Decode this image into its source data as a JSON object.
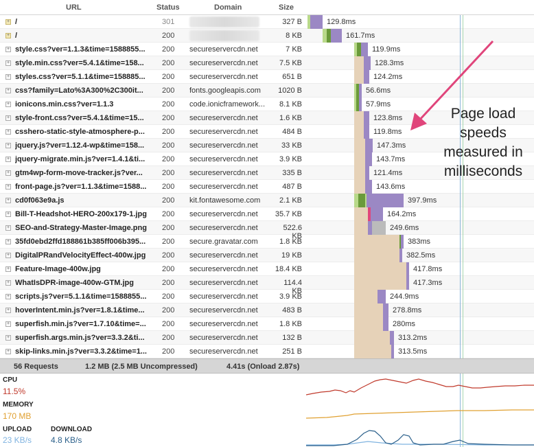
{
  "columns": {
    "url": "URL",
    "status": "Status",
    "domain": "Domain",
    "size": "Size"
  },
  "requests": [
    {
      "url": "/",
      "status": "301",
      "domain": "",
      "size": "327 B",
      "time": "129.8ms"
    },
    {
      "url": "/",
      "status": "200",
      "domain": "",
      "size": "8 KB",
      "time": "161.7ms"
    },
    {
      "url": "style.css?ver=1.1.3&time=1588855...",
      "status": "200",
      "domain": "secureservercdn.net",
      "size": "7 KB",
      "time": "119.9ms"
    },
    {
      "url": "style.min.css?ver=5.4.1&time=158...",
      "status": "200",
      "domain": "secureservercdn.net",
      "size": "7.5 KB",
      "time": "128.3ms"
    },
    {
      "url": "styles.css?ver=5.1.1&time=158885...",
      "status": "200",
      "domain": "secureservercdn.net",
      "size": "651 B",
      "time": "124.2ms"
    },
    {
      "url": "css?family=Lato%3A300%2C300it...",
      "status": "200",
      "domain": "fonts.googleapis.com",
      "size": "1020 B",
      "time": "56.6ms"
    },
    {
      "url": "ionicons.min.css?ver=1.1.3",
      "status": "200",
      "domain": "code.ionicframework...",
      "size": "8.1 KB",
      "time": "57.9ms"
    },
    {
      "url": "style-front.css?ver=5.4.1&time=15...",
      "status": "200",
      "domain": "secureservercdn.net",
      "size": "1.6 KB",
      "time": "123.8ms"
    },
    {
      "url": "csshero-static-style-atmosphere-p...",
      "status": "200",
      "domain": "secureservercdn.net",
      "size": "484 B",
      "time": "119.8ms"
    },
    {
      "url": "jquery.js?ver=1.12.4-wp&time=158...",
      "status": "200",
      "domain": "secureservercdn.net",
      "size": "33 KB",
      "time": "147.3ms"
    },
    {
      "url": "jquery-migrate.min.js?ver=1.4.1&ti...",
      "status": "200",
      "domain": "secureservercdn.net",
      "size": "3.9 KB",
      "time": "143.7ms"
    },
    {
      "url": "gtm4wp-form-move-tracker.js?ver...",
      "status": "200",
      "domain": "secureservercdn.net",
      "size": "335 B",
      "time": "121.4ms"
    },
    {
      "url": "front-page.js?ver=1.1.3&time=1588...",
      "status": "200",
      "domain": "secureservercdn.net",
      "size": "487 B",
      "time": "143.6ms"
    },
    {
      "url": "cd0f063e9a.js",
      "status": "200",
      "domain": "kit.fontawesome.com",
      "size": "2.1 KB",
      "time": "397.9ms"
    },
    {
      "url": "Bill-T-Headshot-HERO-200x179-1.jpg",
      "status": "200",
      "domain": "secureservercdn.net",
      "size": "35.7 KB",
      "time": "164.2ms"
    },
    {
      "url": "SEO-and-Strategy-Master-Image.png",
      "status": "200",
      "domain": "secureservercdn.net",
      "size": "522.6 KB",
      "time": "249.6ms"
    },
    {
      "url": "35fd0ebd2ffd188861b385ff006b395...",
      "status": "200",
      "domain": "secure.gravatar.com",
      "size": "1.8 KB",
      "time": "383ms"
    },
    {
      "url": "DigitalPRandVelocityEffect-400w.jpg",
      "status": "200",
      "domain": "secureservercdn.net",
      "size": "19 KB",
      "time": "382.5ms"
    },
    {
      "url": "Feature-Image-400w.jpg",
      "status": "200",
      "domain": "secureservercdn.net",
      "size": "18.4 KB",
      "time": "417.8ms"
    },
    {
      "url": "WhatIsDPR-image-400w-GTM.jpg",
      "status": "200",
      "domain": "secureservercdn.net",
      "size": "114.4 KB",
      "time": "417.3ms"
    },
    {
      "url": "scripts.js?ver=5.1.1&time=1588855...",
      "status": "200",
      "domain": "secureservercdn.net",
      "size": "3.9 KB",
      "time": "244.9ms"
    },
    {
      "url": "hoverIntent.min.js?ver=1.8.1&time...",
      "status": "200",
      "domain": "secureservercdn.net",
      "size": "483 B",
      "time": "278.8ms"
    },
    {
      "url": "superfish.min.js?ver=1.7.10&time=...",
      "status": "200",
      "domain": "secureservercdn.net",
      "size": "1.8 KB",
      "time": "280ms"
    },
    {
      "url": "superfish.args.min.js?ver=3.3.2&ti...",
      "status": "200",
      "domain": "secureservercdn.net",
      "size": "132 B",
      "time": "313.2ms"
    },
    {
      "url": "skip-links.min.js?ver=3.3.2&time=1...",
      "status": "200",
      "domain": "secureservercdn.net",
      "size": "251 B",
      "time": "313.5ms"
    }
  ],
  "summary": {
    "requests": "56 Requests",
    "size": "1.2 MB  (2.5 MB Uncompressed)",
    "time": "4.41s  (Onload 2.87s)"
  },
  "metrics": {
    "cpu_label": "CPU",
    "cpu_value": "11.5%",
    "memory_label": "MEMORY",
    "memory_value": "170 MB",
    "upload_label": "UPLOAD",
    "upload_value": "23 KB/s",
    "download_label": "DOWNLOAD",
    "download_value": "4.8 KB/s"
  },
  "annotation": {
    "line1": "Page load",
    "line2": "speeds",
    "line3": "measured in",
    "line4": "milliseconds"
  },
  "colors": {
    "cpu": "#c0392b",
    "memory": "#e0a030",
    "upload": "#7fb3e0",
    "download": "#2a5f8a",
    "arrow": "#e0457b",
    "wait": "#e6d2b8",
    "receive": "#9b88c4",
    "connect": "#b9d98a",
    "dns": "#6a9a3a"
  }
}
